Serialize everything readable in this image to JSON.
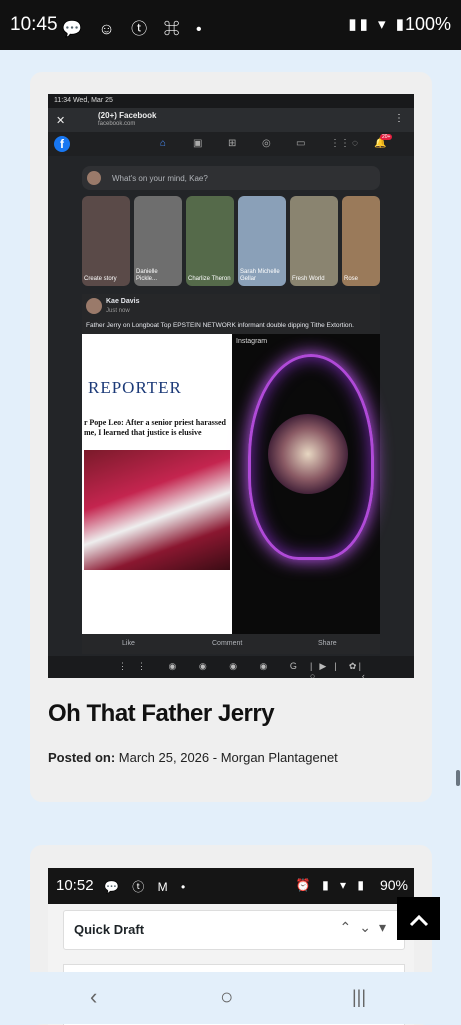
{
  "status": {
    "time": "10:45",
    "left_icons": "💬 ☺ ⓣ ⌘ •",
    "right_icons": "▮▮ ▾ ▮",
    "battery": "100%"
  },
  "post1": {
    "screenshot": {
      "top_time": "11:34 Wed, Mar 25",
      "tab_title": "(20+) Facebook",
      "tab_url": "facebook.com",
      "composer_placeholder": "What's on your mind, Kae?",
      "stories": [
        {
          "name": "Create story"
        },
        {
          "name": "Danielle Pickle..."
        },
        {
          "name": "Charlize Theron"
        },
        {
          "name": "Sarah Michelle Gellar"
        },
        {
          "name": "Fresh World"
        },
        {
          "name": "Rose"
        }
      ],
      "post_author": "Kae Davis",
      "post_time": "Just now",
      "post_text": "Father Jerry on Longboat Top EPSTEIN NETWORK informant double dipping Tithe Extortion.",
      "reporter_title": "REPORTER",
      "headline": "r Pope Leo: After a senior priest harassed me, I learned that justice is elusive",
      "instagram_label": "Instagram",
      "actions": {
        "like": "Like",
        "comment": "Comment",
        "share": "Share"
      },
      "notifications": "20+"
    },
    "title": "Oh That Father Jerry",
    "meta_label": "Posted on:",
    "meta_date": "March 25, 2026",
    "meta_sep": " - ",
    "meta_author": "Morgan Plantagenet"
  },
  "post2": {
    "screenshot": {
      "time": "10:52",
      "battery": "90%",
      "widget_title": "Quick Draft"
    }
  },
  "scroll_top_icon": "chevron-up-icon",
  "nav": {
    "back": "‹",
    "home": "○",
    "recents": "|||"
  }
}
